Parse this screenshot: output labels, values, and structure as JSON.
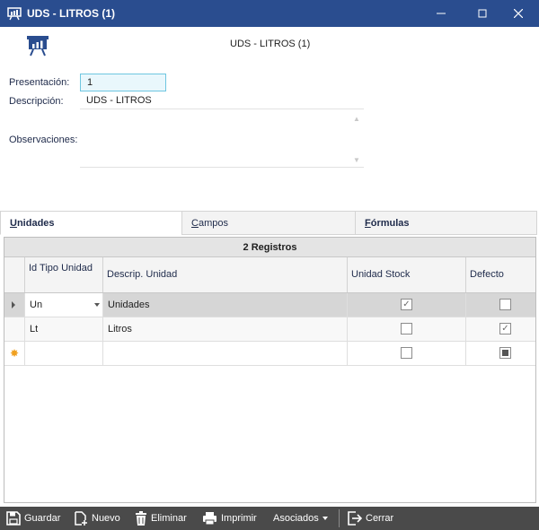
{
  "window": {
    "title": "UDS - LITROS (1)",
    "app_icon": "chart-board-icon",
    "controls": [
      "minimize-icon",
      "maximize-icon",
      "close-icon"
    ]
  },
  "header": {
    "title": "UDS - LITROS (1)",
    "logo": "chart-board-icon"
  },
  "form": {
    "presentacion_label": "Presentación:",
    "presentacion_value": "1",
    "descripcion_label": "Descripción:",
    "descripcion_value": "UDS - LITROS",
    "observaciones_label": "Observaciones:"
  },
  "tabs": [
    {
      "label_first": "U",
      "label_rest": "nidades",
      "active": true
    },
    {
      "label_first": "C",
      "label_rest": "ampos",
      "active": false
    },
    {
      "label_first": "F",
      "label_rest": "órmulas",
      "active": false
    }
  ],
  "grid": {
    "caption": "2 Registros",
    "columns": [
      "Id Tipo Unidad",
      "Descrip. Unidad",
      "Unidad Stock",
      "Defecto"
    ],
    "rows": [
      {
        "id": "Un",
        "descripcion": "Unidades",
        "unidad_stock": true,
        "defecto": false,
        "current": true
      },
      {
        "id": "Lt",
        "descripcion": "Litros",
        "unidad_stock": false,
        "defecto": true,
        "current": false
      },
      {
        "id": "",
        "descripcion": "",
        "unidad_stock": false,
        "defecto": "indeterminate",
        "new_row": true
      }
    ]
  },
  "toolbar": {
    "guardar": "Guardar",
    "nuevo": "Nuevo",
    "eliminar": "Eliminar",
    "imprimir": "Imprimir",
    "asociados": "Asociados",
    "cerrar": "Cerrar"
  },
  "colors": {
    "titlebar": "#2a4d8f",
    "toolbar": "#4a4a4a",
    "input_focus_border": "#6ec6e0"
  }
}
